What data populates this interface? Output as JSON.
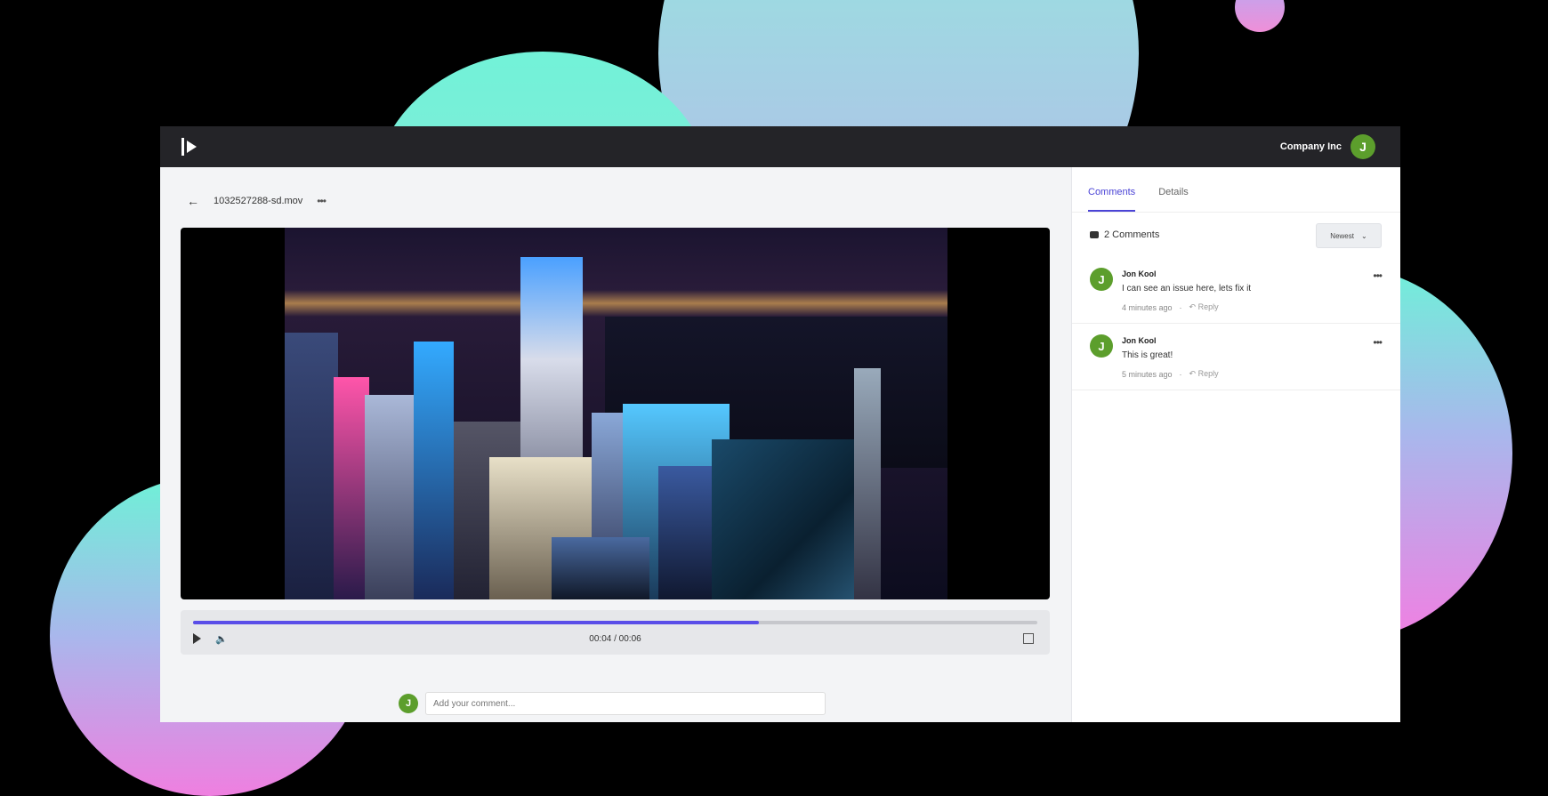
{
  "header": {
    "company_name": "Company Inc",
    "avatar_initial": "J"
  },
  "file": {
    "name": "1032527288-sd.mov",
    "more_icon": "more-dots-icon"
  },
  "player": {
    "progress": 0.67,
    "time_display": "00:04 / 00:06",
    "accent": "#5a4ee8"
  },
  "comment_input": {
    "avatar_initial": "J",
    "placeholder": "Add your comment..."
  },
  "sidebar": {
    "tabs": [
      {
        "label": "Comments",
        "active": true
      },
      {
        "label": "Details",
        "active": false
      }
    ],
    "comments_count": "2 Comments",
    "sort_label": "Newest",
    "comments": [
      {
        "initial": "J",
        "author": "Jon Kool",
        "text": "I can see an issue here, lets fix it",
        "time": "4 minutes ago",
        "reply": "Reply"
      },
      {
        "initial": "J",
        "author": "Jon Kool",
        "text": "This is great!",
        "time": "5 minutes ago",
        "reply": "Reply"
      }
    ]
  }
}
